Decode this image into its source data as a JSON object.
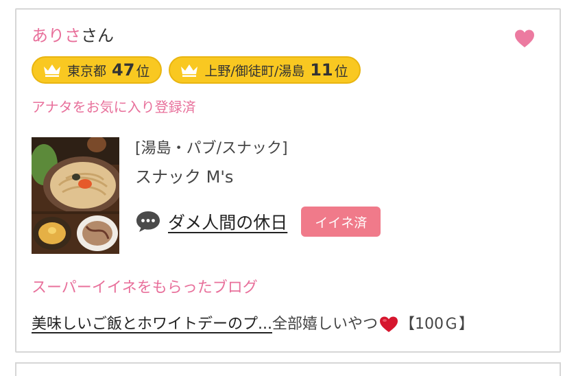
{
  "user": {
    "name": "ありさ",
    "suffix": "さん"
  },
  "favorite_icon": "heart-icon",
  "rankings": [
    {
      "area": "東京都",
      "rank": "47",
      "unit": "位",
      "icon": "crown-icon"
    },
    {
      "area": "上野/御徒町/湯島",
      "rank": "11",
      "unit": "位",
      "icon": "crown-icon"
    }
  ],
  "favorite_status": "アナタをお気に入り登録済",
  "shop": {
    "category": "[湯島・パブ/スナック]",
    "name": "スナック M's"
  },
  "blog": {
    "icon": "speech-bubble-icon",
    "title": "ダメ人間の休日",
    "like_label": "イイネ済"
  },
  "super_like": {
    "heading": "スーパーイイネをもらったブログ",
    "blog_title": "美味しいご飯とホワイトデーのプ...",
    "comment": "全部嬉しいやつ",
    "comment_icon": "red-heart-icon",
    "points": "【100Ｇ】"
  },
  "colors": {
    "accent_pink": "#e8709b",
    "badge_gold": "#f9c821",
    "like_button": "#f07a8a",
    "border": "#d6d6d6"
  }
}
